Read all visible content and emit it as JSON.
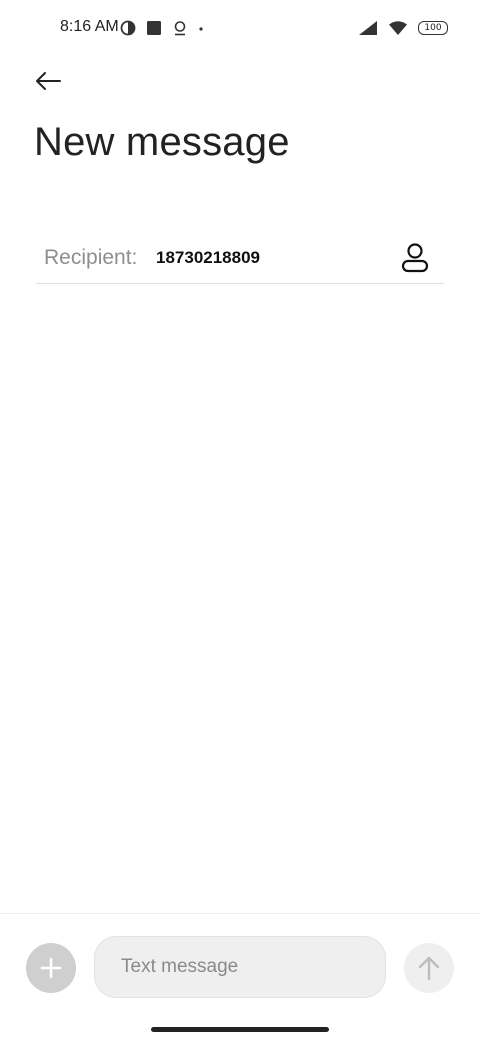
{
  "status_bar": {
    "time": "8:16 AM",
    "left_icons": [
      "data-saver-icon",
      "square-notification-icon",
      "location-notification-icon",
      "more-dot-icon"
    ],
    "right_icons": [
      "cellular-signal-icon",
      "wifi-icon",
      "battery-icon"
    ],
    "battery_level": "100"
  },
  "header": {
    "back_icon": "arrow-left-icon",
    "title": "New message"
  },
  "recipient": {
    "label": "Recipient:",
    "value": "18730218809",
    "contact_icon": "person-icon"
  },
  "composer": {
    "add_icon": "plus-icon",
    "placeholder": "Text message",
    "send_icon": "arrow-up-icon"
  },
  "colors": {
    "background": "#ffffff",
    "title_text": "#222222",
    "label_text": "#8e8e8e",
    "add_button_bg": "#cfcfcf",
    "input_bg": "#efefef"
  }
}
